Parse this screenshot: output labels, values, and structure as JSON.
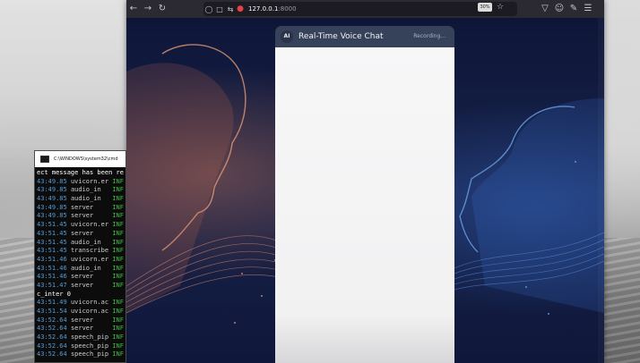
{
  "browser": {
    "url_host": "127.0.0.1",
    "url_port": ":8000",
    "zoom": "30%",
    "icons": {
      "back": "back-arrow-icon",
      "forward": "forward-arrow-icon",
      "reload": "reload-icon",
      "shield": "shield-icon",
      "page": "page-icon",
      "permissions": "permissions-icon",
      "mic": "microphone-icon",
      "star": "star-icon",
      "pocket": "pocket-icon",
      "account": "account-icon",
      "extensions": "extensions-icon",
      "menu": "hamburger-menu-icon"
    }
  },
  "chat": {
    "badge": "AI",
    "title": "Real-Time Voice Chat",
    "status": "Recording..."
  },
  "terminal": {
    "title": "C:\\WINDOWS\\system32\\cmd",
    "lines": [
      {
        "plain": "ect message has been re"
      },
      {
        "ts": "43:49.85",
        "mod": "uvicorn.er",
        "lvl": "INF"
      },
      {
        "ts": "43:49.85",
        "mod": "audio_in",
        "lvl": "INF"
      },
      {
        "ts": "43:49.85",
        "mod": "audio_in",
        "lvl": "INF"
      },
      {
        "ts": "43:49.85",
        "mod": "server",
        "lvl": "INF"
      },
      {
        "ts": "43:49.85",
        "mod": "server",
        "lvl": "INF"
      },
      {
        "ts": "43:51.45",
        "mod": "uvicorn.er",
        "lvl": "INF"
      },
      {
        "ts": "43:51.45",
        "mod": "server",
        "lvl": "INF"
      },
      {
        "ts": "43:51.45",
        "mod": "audio_in",
        "lvl": "INF"
      },
      {
        "ts": "43:51.45",
        "mod": "transcribe",
        "lvl": "INF"
      },
      {
        "ts": "43:51.46",
        "mod": "uvicorn.er",
        "lvl": "INF"
      },
      {
        "ts": "43:51.46",
        "mod": "audio_in",
        "lvl": "INF"
      },
      {
        "ts": "43:51.46",
        "mod": "server",
        "lvl": "INF"
      },
      {
        "ts": "43:51.47",
        "mod": "server",
        "lvl": "INF"
      },
      {
        "plain": "c_inter 0"
      },
      {
        "ts": "43:51.49",
        "mod": "uvicorn.ac",
        "lvl": "INF"
      },
      {
        "ts": "43:51.54",
        "mod": "uvicorn.ac",
        "lvl": "INF"
      },
      {
        "ts": "43:52.64",
        "mod": "server",
        "lvl": "INF"
      },
      {
        "ts": "43:52.64",
        "mod": "server",
        "lvl": "INF"
      },
      {
        "ts": "43:52.64",
        "mod": "speech_pip",
        "lvl": "INF"
      },
      {
        "ts": "43:52.64",
        "mod": "speech_pip",
        "lvl": "INF"
      },
      {
        "ts": "43:52.64",
        "mod": "speech_pip",
        "lvl": "INF"
      }
    ]
  }
}
